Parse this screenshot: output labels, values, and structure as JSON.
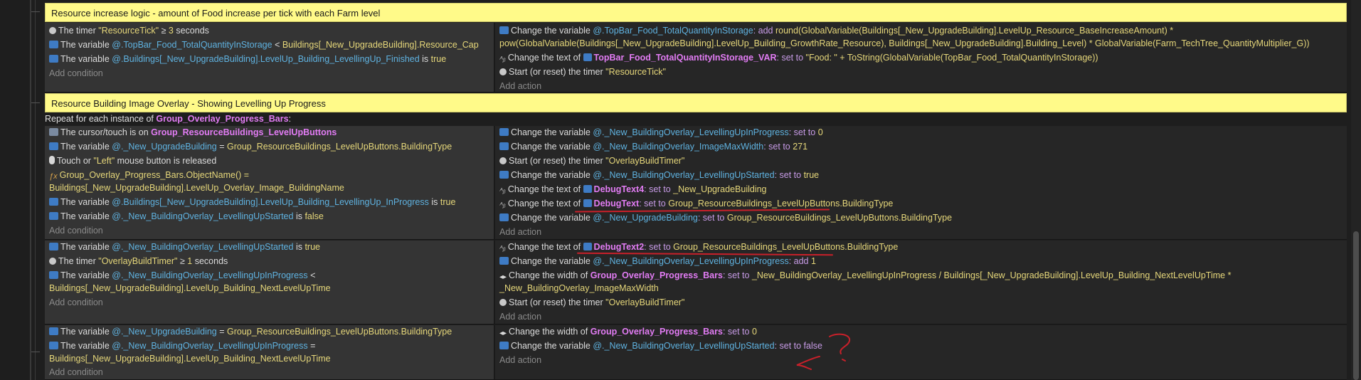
{
  "block1": {
    "comment": "Resource increase logic - amount of Food increase per tick with each Farm level",
    "conditions": [
      {
        "pre": "The timer ",
        "s1": "\"ResourceTick\"",
        "mid": " ≥ ",
        "n": "3",
        "post": " seconds"
      },
      {
        "pre": "The variable ",
        "v": "@.TopBar_Food_TotalQuantityInStorage",
        "mid": " < ",
        "e": "Buildings[_New_UpgradeBuilding].Resource_Cap"
      },
      {
        "pre": "The variable ",
        "v": "@.Buildings[_New_UpgradeBuilding].LevelUp_Building_LevellingUp_Finished",
        "mid": " is ",
        "e": "true"
      }
    ],
    "add_condition": "Add condition",
    "actions": [
      {
        "pre": "Change the variable ",
        "v": "@.TopBar_Food_TotalQuantityInStorage",
        "kw": ": add ",
        "e": "round(GlobalVariable(Buildings[_New_UpgradeBuilding].LevelUp_Resource_BaseIncreaseAmount) *"
      },
      {
        "cont": "pow(GlobalVariable(Buildings[_New_UpgradeBuilding].LevelUp_Building_GrowthRate_Resource), Buildings[_New_UpgradeBuilding].Building_Level) * GlobalVariable(Farm_TechTree_QuantityMultiplier_G))"
      },
      {
        "pre": "Change the text of ",
        "o": "TopBar_Food_TotalQuantityInStorage_VAR",
        "kw": ": set to ",
        "e": "\"Food: \" + ToString(GlobalVariable(TopBar_Food_TotalQuantityInStorage))"
      },
      {
        "pre": "Start (or reset) the timer ",
        "e": "\"ResourceTick\""
      }
    ],
    "add_action": "Add action"
  },
  "block2": {
    "comment": "Resource Building Image Overlay - Showing Levelling Up Progress",
    "repeat_pre": "Repeat for each instance of ",
    "repeat_obj": "Group_Overlay_Progress_Bars",
    "repeat_post": ":",
    "ev1": {
      "conditions": [
        {
          "pre": "The cursor/touch is on ",
          "o": "Group_ResourceBuildings_LevelUpButtons"
        },
        {
          "pre": "The variable ",
          "v": "@._New_UpgradeBuilding",
          "mid": " = ",
          "e": "Group_ResourceBuildings_LevelUpButtons.BuildingType"
        },
        {
          "pre": "Touch or ",
          "e": "\"Left\"",
          "post": " mouse button is released"
        },
        {
          "e": "Group_Overlay_Progress_Bars.ObjectName() =",
          "fx": true
        },
        {
          "cont": "Buildings[_New_UpgradeBuilding].LevelUp_Overlay_Image_BuildingName"
        },
        {
          "pre": "The variable ",
          "v": "@.Buildings[_New_UpgradeBuilding].LevelUp_Building_LevellingUp_InProgress",
          "mid": " is ",
          "e": "true"
        },
        {
          "pre": "The variable ",
          "v": "@._New_BuildingOverlay_LevellingUpStarted",
          "mid": " is ",
          "e": "false"
        }
      ],
      "add_condition": "Add condition",
      "actions": [
        {
          "pre": "Change the variable ",
          "v": "@._New_BuildingOverlay_LevellingUpInProgress",
          "kw": ": set to ",
          "e": "0"
        },
        {
          "pre": "Change the variable ",
          "v": "@._New_BuildingOverlay_ImageMaxWidth",
          "kw": ": set to ",
          "e": "271"
        },
        {
          "pre": "Start (or reset) the timer ",
          "e": "\"OverlayBuildTimer\""
        },
        {
          "pre": "Change the variable ",
          "v": "@._New_BuildingOverlay_LevellingUpStarted",
          "kw": ": set to ",
          "e": "true"
        },
        {
          "pre": "Change the text of ",
          "o": "DebugText4",
          "kw": ": set to ",
          "e": "_New_UpgradeBuilding"
        },
        {
          "pre": "Change the text of ",
          "o": "DebugText",
          "kw": ": set to ",
          "e": "Group_ResourceBuildings_LevelUpButtons.BuildingType"
        },
        {
          "pre": "Change the variable ",
          "v": "@._New_UpgradeBuilding",
          "kw": ": set to ",
          "e": "Group_ResourceBuildings_LevelUpButtons.BuildingType"
        }
      ],
      "add_action": "Add action"
    },
    "ev2": {
      "conditions": [
        {
          "pre": "The variable ",
          "v": "@._New_BuildingOverlay_LevellingUpStarted",
          "mid": " is ",
          "e": "true"
        },
        {
          "pre": "The timer ",
          "e": "\"OverlayBuildTimer\"",
          "mid": " ≥ ",
          "n": "1",
          "post": " seconds"
        },
        {
          "pre": "The variable ",
          "v": "@._New_BuildingOverlay_LevellingUpInProgress",
          "mid": " <"
        },
        {
          "cont": "Buildings[_New_UpgradeBuilding].LevelUp_Building_NextLevelUpTime"
        }
      ],
      "add_condition": "Add condition",
      "actions": [
        {
          "pre": "Change the text of ",
          "o": "DebugText2",
          "kw": ": set to ",
          "e": "Group_ResourceBuildings_LevelUpButtons.BuildingType"
        },
        {
          "pre": "Change the variable ",
          "v": "@._New_BuildingOverlay_LevellingUpInProgress",
          "kw": ": add ",
          "e": "1"
        },
        {
          "pre": "Change the width of ",
          "o": "Group_Overlay_Progress_Bars",
          "kw": ": set to ",
          "e": "_New_BuildingOverlay_LevellingUpInProgress / Buildings[_New_UpgradeBuilding].LevelUp_Building_NextLevelUpTime *"
        },
        {
          "cont": "_New_BuildingOverlay_ImageMaxWidth"
        },
        {
          "pre": "Start (or reset) the timer ",
          "e": "\"OverlayBuildTimer\""
        }
      ],
      "add_action": "Add action"
    },
    "ev3": {
      "conditions": [
        {
          "pre": "The variable ",
          "v": "@._New_UpgradeBuilding",
          "mid": " = ",
          "e": "Group_ResourceBuildings_LevelUpButtons.BuildingType"
        },
        {
          "pre": "The variable ",
          "v": "@._New_BuildingOverlay_LevellingUpInProgress",
          "mid": " ="
        },
        {
          "cont": "Buildings[_New_UpgradeBuilding].LevelUp_Building_NextLevelUpTime"
        }
      ],
      "add_condition": "Add condition",
      "actions": [
        {
          "pre": "Change the width of ",
          "o": "Group_Overlay_Progress_Bars",
          "kw": ": set to ",
          "e": "0"
        },
        {
          "pre": "Change the variable ",
          "v": "@._New_BuildingOverlay_LevellingUpStarted",
          "kw": ": set to false"
        }
      ],
      "add_action": "Add action"
    }
  },
  "colors": {
    "comment_bg": "#fffa89",
    "object": "#e27cf4",
    "variable": "#5fb2e0",
    "expression": "#e6d77a",
    "keyword": "#c79be6",
    "annotation_red": "#c8202a"
  }
}
